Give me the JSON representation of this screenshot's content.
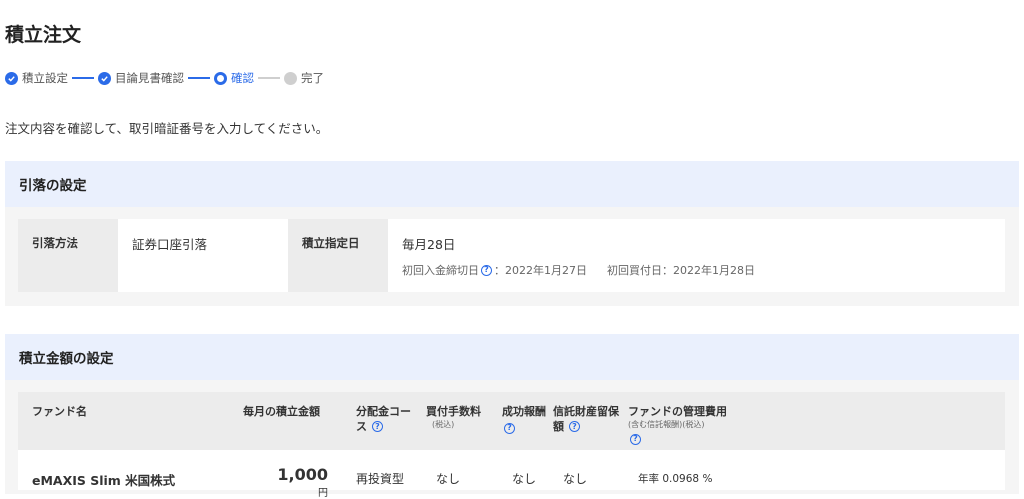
{
  "page": {
    "title": "積立注文",
    "instruction": "注文内容を確認して、取引暗証番号を入力してください。"
  },
  "steps": [
    {
      "label": "積立設定",
      "state": "done"
    },
    {
      "label": "目論見書確認",
      "state": "done"
    },
    {
      "label": "確認",
      "state": "current"
    },
    {
      "label": "完了",
      "state": "todo"
    }
  ],
  "debit_section": {
    "title": "引落の設定",
    "method_label": "引落方法",
    "method_value": "証券口座引落",
    "date_label": "積立指定日",
    "date_value": "毎月28日",
    "first_deposit_label": "初回入金締切日",
    "first_deposit_value": "：2022年1月27日",
    "first_buy_label": "初回買付日",
    "first_buy_value": "：2022年1月28日"
  },
  "amount_section": {
    "title": "積立金額の設定",
    "headers": {
      "fund_name": "ファンド名",
      "monthly_amount": "毎月の積立金額",
      "dividend_course_1": "分配金コー",
      "dividend_course_2": "ス",
      "purchase_fee": "買付手数料",
      "purchase_fee_note": "(税込)",
      "success_fee": "成功報酬",
      "trust_reserve_1": "信託財産留保",
      "trust_reserve_2": "額",
      "mgmt_cost": "ファンドの管理費用",
      "mgmt_cost_note": "(含む信託報酬)(税込)"
    },
    "rows": [
      {
        "fund_name": "eMAXIS Slim 米国株式",
        "amount": "1,000",
        "unit": "円",
        "dividend_course": "再投資型",
        "purchase_fee": "なし",
        "success_fee": "なし",
        "trust_reserve": "なし",
        "mgmt_cost_prefix": "年率",
        "mgmt_cost_value": "0.0968",
        "mgmt_cost_unit": "%"
      }
    ]
  },
  "colors": {
    "accent": "#2b6be8",
    "section_header_bg": "#eaf0fd",
    "section_bg": "#f5f5f5",
    "cell_head_bg": "#ececec",
    "inactive": "#cfcfcf"
  },
  "icons": {
    "done": "check-circle-icon",
    "current": "ring-icon",
    "todo": "grey-dot-icon",
    "help": "question-circle-icon"
  }
}
